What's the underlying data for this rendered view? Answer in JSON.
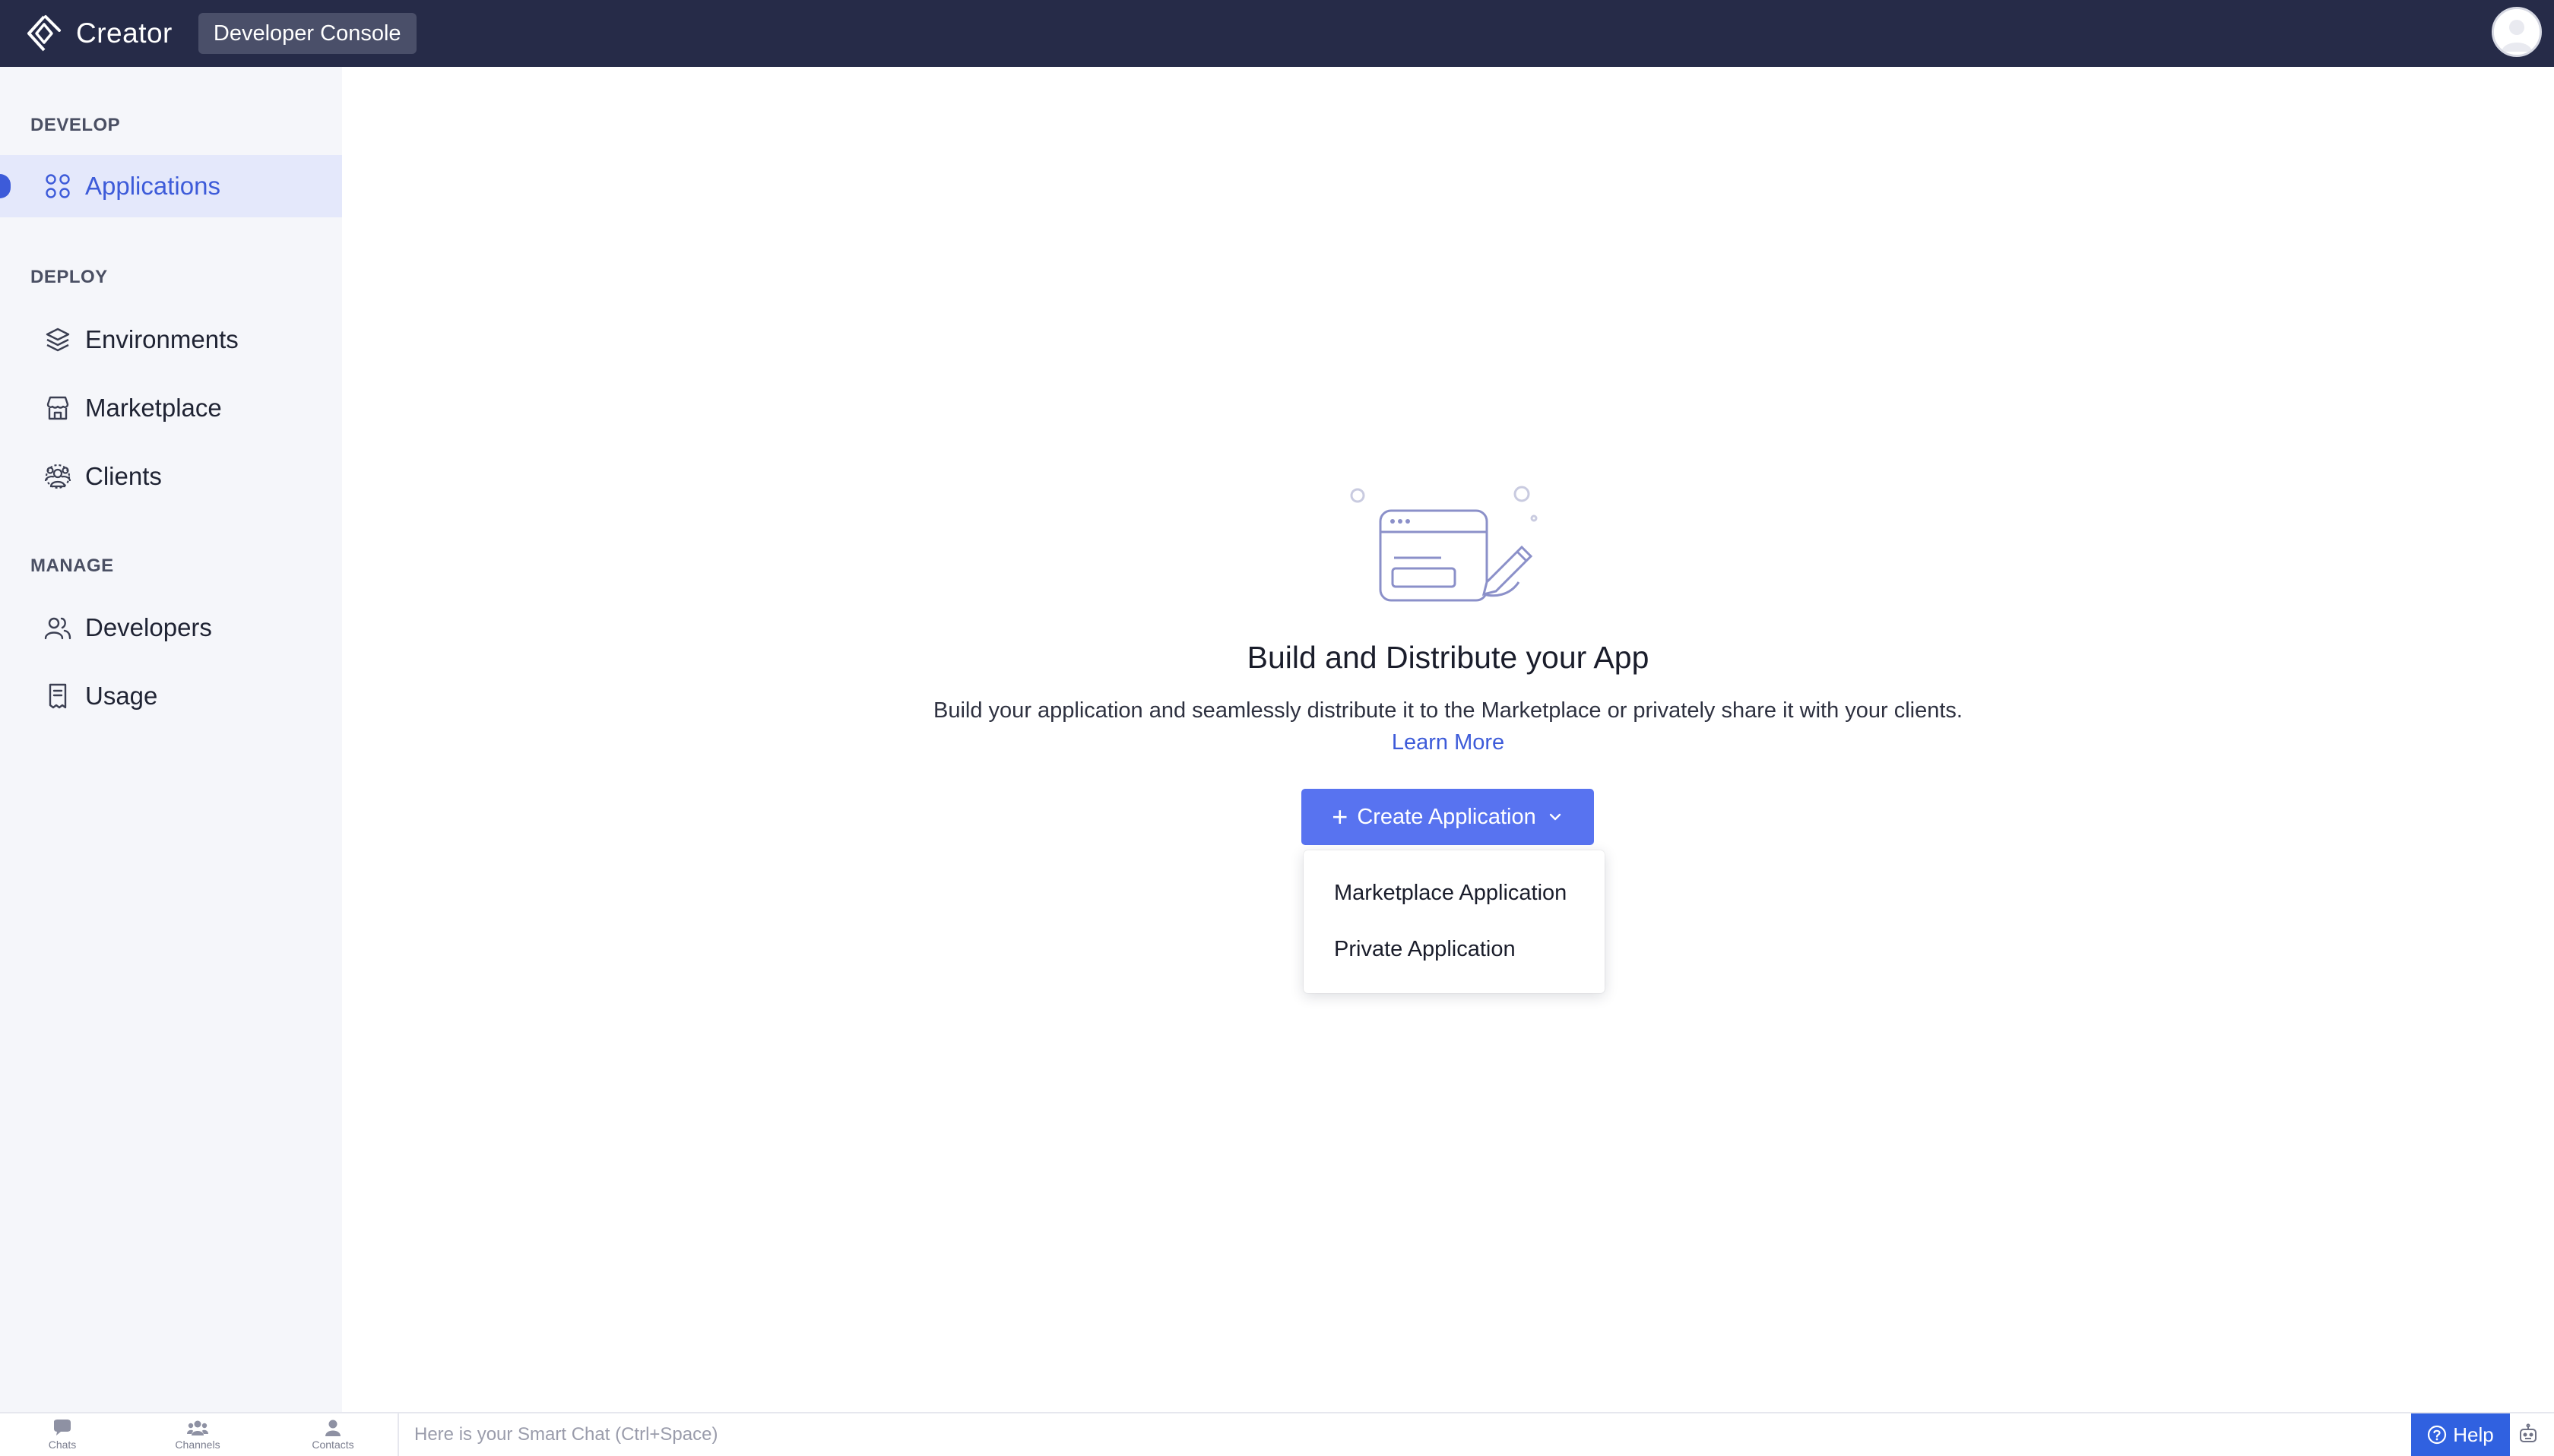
{
  "header": {
    "brand_name": "Creator",
    "brand_icon": "creator-logo-icon",
    "console_label": "Developer Console",
    "avatar_icon": "user-avatar-icon"
  },
  "sidebar": {
    "sections": [
      {
        "title": "DEVELOP",
        "items": [
          {
            "label": "Applications",
            "icon": "grid-icon",
            "active": true
          }
        ]
      },
      {
        "title": "DEPLOY",
        "items": [
          {
            "label": "Environments",
            "icon": "layers-icon"
          },
          {
            "label": "Marketplace",
            "icon": "store-icon"
          },
          {
            "label": "Clients",
            "icon": "clients-icon"
          }
        ]
      },
      {
        "title": "MANAGE",
        "items": [
          {
            "label": "Developers",
            "icon": "users-icon"
          },
          {
            "label": "Usage",
            "icon": "receipt-icon"
          }
        ]
      }
    ]
  },
  "main": {
    "illustration_icon": "browser-pencil-illustration",
    "title": "Build and Distribute your App",
    "description": "Build your application and seamlessly distribute it to the Marketplace or privately share it with your clients.",
    "learn_more": "Learn More",
    "create_button": "Create Application",
    "dropdown_options": [
      "Marketplace Application",
      "Private Application"
    ]
  },
  "bottombar": {
    "tabs": [
      {
        "label": "Chats",
        "icon": "chat-icon"
      },
      {
        "label": "Channels",
        "icon": "channels-icon"
      },
      {
        "label": "Contacts",
        "icon": "contact-icon"
      }
    ],
    "smart_chat_placeholder": "Here is your Smart Chat (Ctrl+Space)",
    "help_label": "Help"
  },
  "colors": {
    "header_bg": "#262b48",
    "sidebar_bg": "#f5f6fa",
    "accent": "#3d5bd9",
    "button_bg": "#5873f0",
    "help_bg": "#3061e0"
  }
}
